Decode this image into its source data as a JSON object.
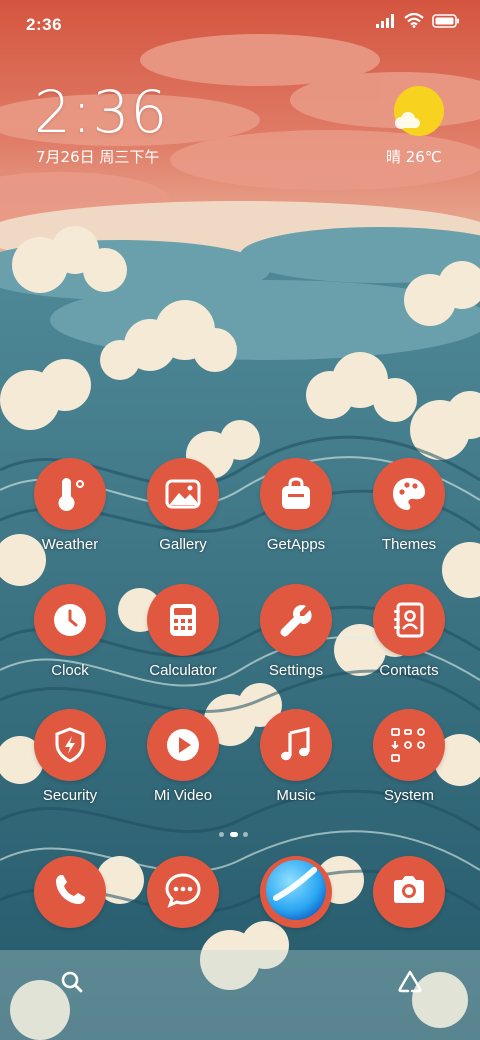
{
  "status_bar": {
    "time": "2:36",
    "icons": [
      "signal-icon",
      "wifi-icon",
      "battery-icon"
    ]
  },
  "clock_widget": {
    "time": "2:36",
    "date": "7月26日 周三下午"
  },
  "weather_widget": {
    "icon": "sunny-cloud-icon",
    "text": "晴 26℃"
  },
  "apps": [
    {
      "label": "Weather",
      "icon": "thermometer-icon"
    },
    {
      "label": "Gallery",
      "icon": "image-icon"
    },
    {
      "label": "GetApps",
      "icon": "shopping-bag-icon"
    },
    {
      "label": "Themes",
      "icon": "palette-icon"
    },
    {
      "label": "Clock",
      "icon": "clock-icon"
    },
    {
      "label": "Calculator",
      "icon": "calculator-icon"
    },
    {
      "label": "Settings",
      "icon": "wrench-icon"
    },
    {
      "label": "Contacts",
      "icon": "contacts-book-icon"
    },
    {
      "label": "Security",
      "icon": "shield-bolt-icon"
    },
    {
      "label": "Mi Video",
      "icon": "play-icon"
    },
    {
      "label": "Music",
      "icon": "music-note-icon"
    },
    {
      "label": "System",
      "icon": "folder-icon"
    }
  ],
  "dock": [
    {
      "icon": "phone-icon"
    },
    {
      "icon": "message-icon"
    },
    {
      "icon": "browser-icon"
    },
    {
      "icon": "camera-icon"
    }
  ],
  "bottom_row": [
    "search-icon",
    "recycle-icon"
  ],
  "colors": {
    "icon_background": "#e15841",
    "sky": "#d65a48",
    "sea": "#2f6f80",
    "foam": "#f1e6cf",
    "sun": "#f7d21e"
  }
}
